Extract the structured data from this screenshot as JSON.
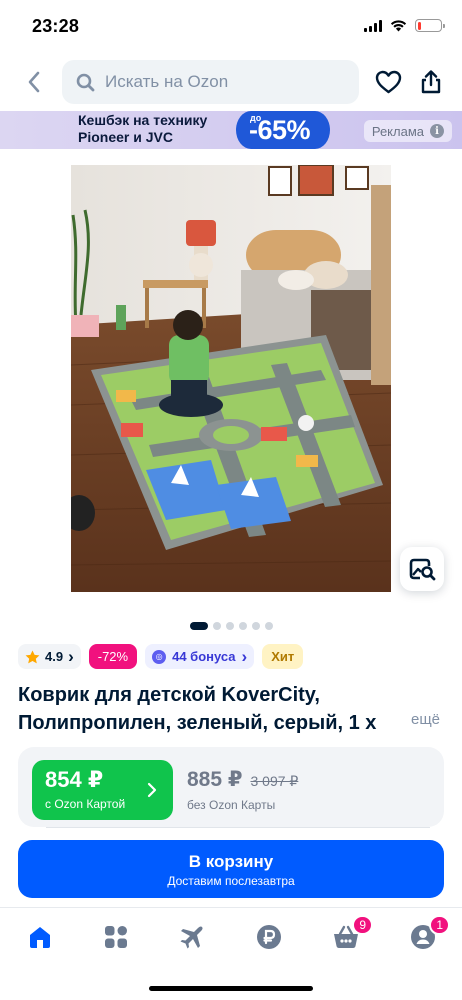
{
  "status_bar": {
    "time": "23:28",
    "battery_level": 0.15
  },
  "header": {
    "search_placeholder": "Искать на Ozon",
    "icons": [
      "chevron-left-icon",
      "search-icon",
      "heart-icon",
      "share-icon"
    ]
  },
  "banner": {
    "line1": "Кешбэк на технику",
    "line2": "Pioneer и JVC",
    "prefix": "до",
    "discount": "-65%",
    "ad_label": "Реклама",
    "info_glyph": "i"
  },
  "gallery": {
    "pages": 6,
    "active_page": 1
  },
  "badges": {
    "rating": "4.9",
    "rating_chevron": "›",
    "discount": "-72%",
    "bonus": "44 бонуса",
    "bonus_chevron": "›",
    "hit": "Хит"
  },
  "product": {
    "title": "Коврик для детской KoverCity, Полипропилен, зеленый, серый, 1 х",
    "more": "ещё"
  },
  "price": {
    "card_price": "854 ₽",
    "card_label": "с Ozon Картой",
    "regular_price": "885 ₽",
    "old_price": "3 097 ₽",
    "regular_label": "без Ozon Карты"
  },
  "cart_button": {
    "label": "В корзину",
    "sub": "Доставим послезавтра"
  },
  "tabbar": {
    "cart_count": "9",
    "profile_count": "1"
  },
  "colors": {
    "accent": "#005bff",
    "green": "#10c44c",
    "pink": "#f1117e"
  }
}
